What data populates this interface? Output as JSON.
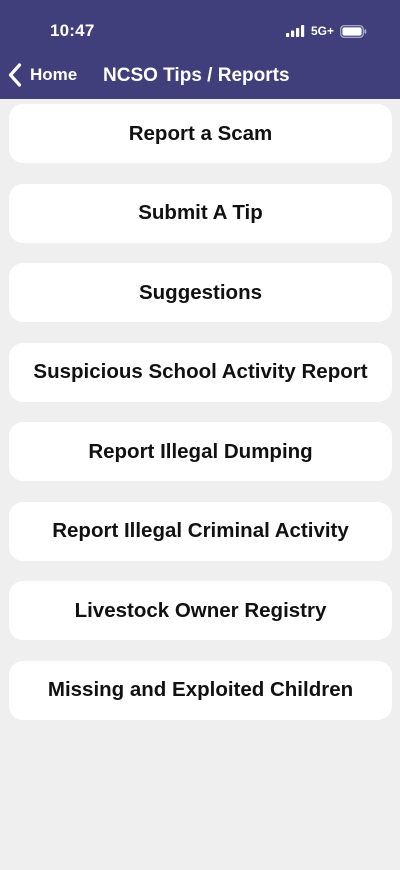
{
  "status_bar": {
    "time": "10:47",
    "network": "5G+",
    "signal_icon": "signal-bars-icon",
    "battery_icon": "battery-icon"
  },
  "nav": {
    "back_icon": "chevron-left-icon",
    "back_label": "Home",
    "title": "NCSO Tips / Reports"
  },
  "colors": {
    "header_background": "#403f7c",
    "page_background": "#efefef",
    "card_background": "#ffffff"
  },
  "menu": {
    "items": [
      {
        "label": "Report a Scam"
      },
      {
        "label": "Submit A Tip"
      },
      {
        "label": "Suggestions"
      },
      {
        "label": "Suspicious School Activity Report"
      },
      {
        "label": "Report Illegal Dumping"
      },
      {
        "label": "Report Illegal Criminal Activity"
      },
      {
        "label": "Livestock Owner Registry"
      },
      {
        "label": "Missing and Exploited Children"
      }
    ]
  }
}
